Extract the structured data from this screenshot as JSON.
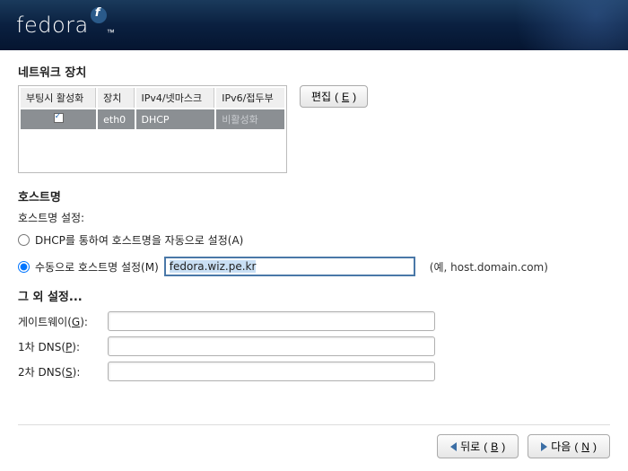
{
  "header": {
    "logo_text": "fedora",
    "logo_tm": "™"
  },
  "network": {
    "title": "네트워크 장치",
    "columns": [
      "부팅시 활성화",
      "장치",
      "IPv4/넷마스크",
      "IPv6/접두부"
    ],
    "row": {
      "active": true,
      "device": "eth0",
      "ipv4": "DHCP",
      "ipv6": "비활성화"
    },
    "edit_label": "편집",
    "edit_key": "E"
  },
  "hostname": {
    "title": "호스트명",
    "setting_label": "호스트명 설정:",
    "radio_dhcp": "DHCP를 통하여 호스트명을 자동으로 설정",
    "radio_dhcp_key": "A",
    "radio_manual": "수동으로 호스트명 설정",
    "radio_manual_key": "M",
    "value": "fedora.wiz.pe.kr",
    "example": "(예, host.domain.com)"
  },
  "other": {
    "title": "그 외 설정...",
    "gateway_label": "게이트웨이",
    "gateway_key": "G",
    "dns1_label": "1차 DNS",
    "dns1_key": "P",
    "dns2_label": "2차 DNS",
    "dns2_key": "S",
    "gateway_value": "",
    "dns1_value": "",
    "dns2_value": ""
  },
  "footer": {
    "back_label": "뒤로",
    "back_key": "B",
    "next_label": "다음",
    "next_key": "N"
  }
}
